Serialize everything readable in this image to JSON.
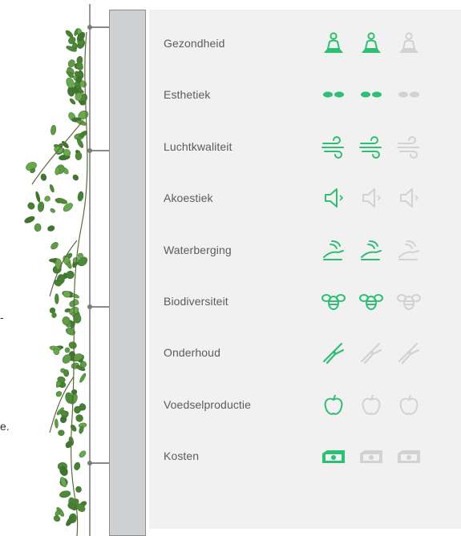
{
  "stray_text": {
    "left_dash": "-",
    "left_dot": "e."
  },
  "colors": {
    "active": "#2fbf74",
    "inactive": "#d1d2d4",
    "label": "#5c5c5c",
    "panel": "#f1f1f1",
    "wall": "#cfd0d2"
  },
  "criteria": [
    {
      "label": "Gezondheid",
      "icon": "person-meditation-icon",
      "score": 2,
      "max": 3
    },
    {
      "label": "Esthetiek",
      "icon": "dots-pair-icon",
      "score": 2,
      "max": 3
    },
    {
      "label": "Luchtkwaliteit",
      "icon": "wind-icon",
      "score": 2,
      "max": 3
    },
    {
      "label": "Akoestiek",
      "icon": "speaker-icon",
      "score": 1,
      "max": 3
    },
    {
      "label": "Waterberging",
      "icon": "water-hand-icon",
      "score": 2,
      "max": 3
    },
    {
      "label": "Biodiversiteit",
      "icon": "bee-icon",
      "score": 2,
      "max": 3
    },
    {
      "label": "Onderhoud",
      "icon": "pruning-shears-icon",
      "score": 1,
      "max": 3
    },
    {
      "label": "Voedselproductie",
      "icon": "apple-icon",
      "score": 1,
      "max": 3
    },
    {
      "label": "Kosten",
      "icon": "money-bundle-icon",
      "score": 1,
      "max": 3
    }
  ]
}
